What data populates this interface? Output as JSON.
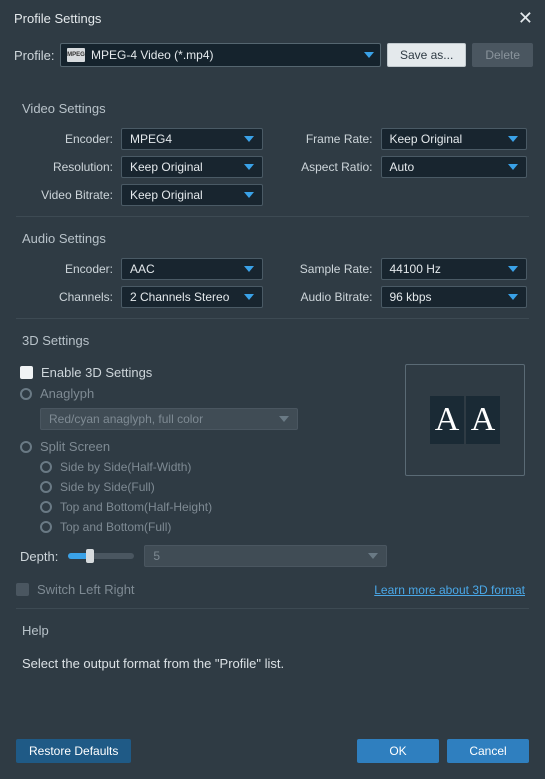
{
  "title": "Profile Settings",
  "profile": {
    "label": "Profile:",
    "value": "MPEG-4 Video (*.mp4)",
    "icon_text": "MPEG",
    "save_as": "Save as...",
    "delete": "Delete"
  },
  "video": {
    "head": "Video Settings",
    "encoder": {
      "label": "Encoder:",
      "value": "MPEG4"
    },
    "resolution": {
      "label": "Resolution:",
      "value": "Keep Original"
    },
    "bitrate": {
      "label": "Video Bitrate:",
      "value": "Keep Original"
    },
    "frame_rate": {
      "label": "Frame Rate:",
      "value": "Keep Original"
    },
    "aspect": {
      "label": "Aspect Ratio:",
      "value": "Auto"
    }
  },
  "audio": {
    "head": "Audio Settings",
    "encoder": {
      "label": "Encoder:",
      "value": "AAC"
    },
    "channels": {
      "label": "Channels:",
      "value": "2 Channels Stereo"
    },
    "sample_rate": {
      "label": "Sample Rate:",
      "value": "44100 Hz"
    },
    "bitrate": {
      "label": "Audio Bitrate:",
      "value": "96 kbps"
    }
  },
  "s3d": {
    "head": "3D Settings",
    "enable": "Enable 3D Settings",
    "anaglyph": "Anaglyph",
    "anaglyph_mode": "Red/cyan anaglyph, full color",
    "split": "Split Screen",
    "sbs_half": "Side by Side(Half-Width)",
    "sbs_full": "Side by Side(Full)",
    "tab_half": "Top and Bottom(Half-Height)",
    "tab_full": "Top and Bottom(Full)",
    "depth_label": "Depth:",
    "depth_value": "5",
    "switch_lr": "Switch Left Right",
    "learn_more": "Learn more about 3D format",
    "preview_glyph": "A"
  },
  "help": {
    "head": "Help",
    "body": "Select the output format from the \"Profile\" list."
  },
  "footer": {
    "restore": "Restore Defaults",
    "ok": "OK",
    "cancel": "Cancel"
  }
}
